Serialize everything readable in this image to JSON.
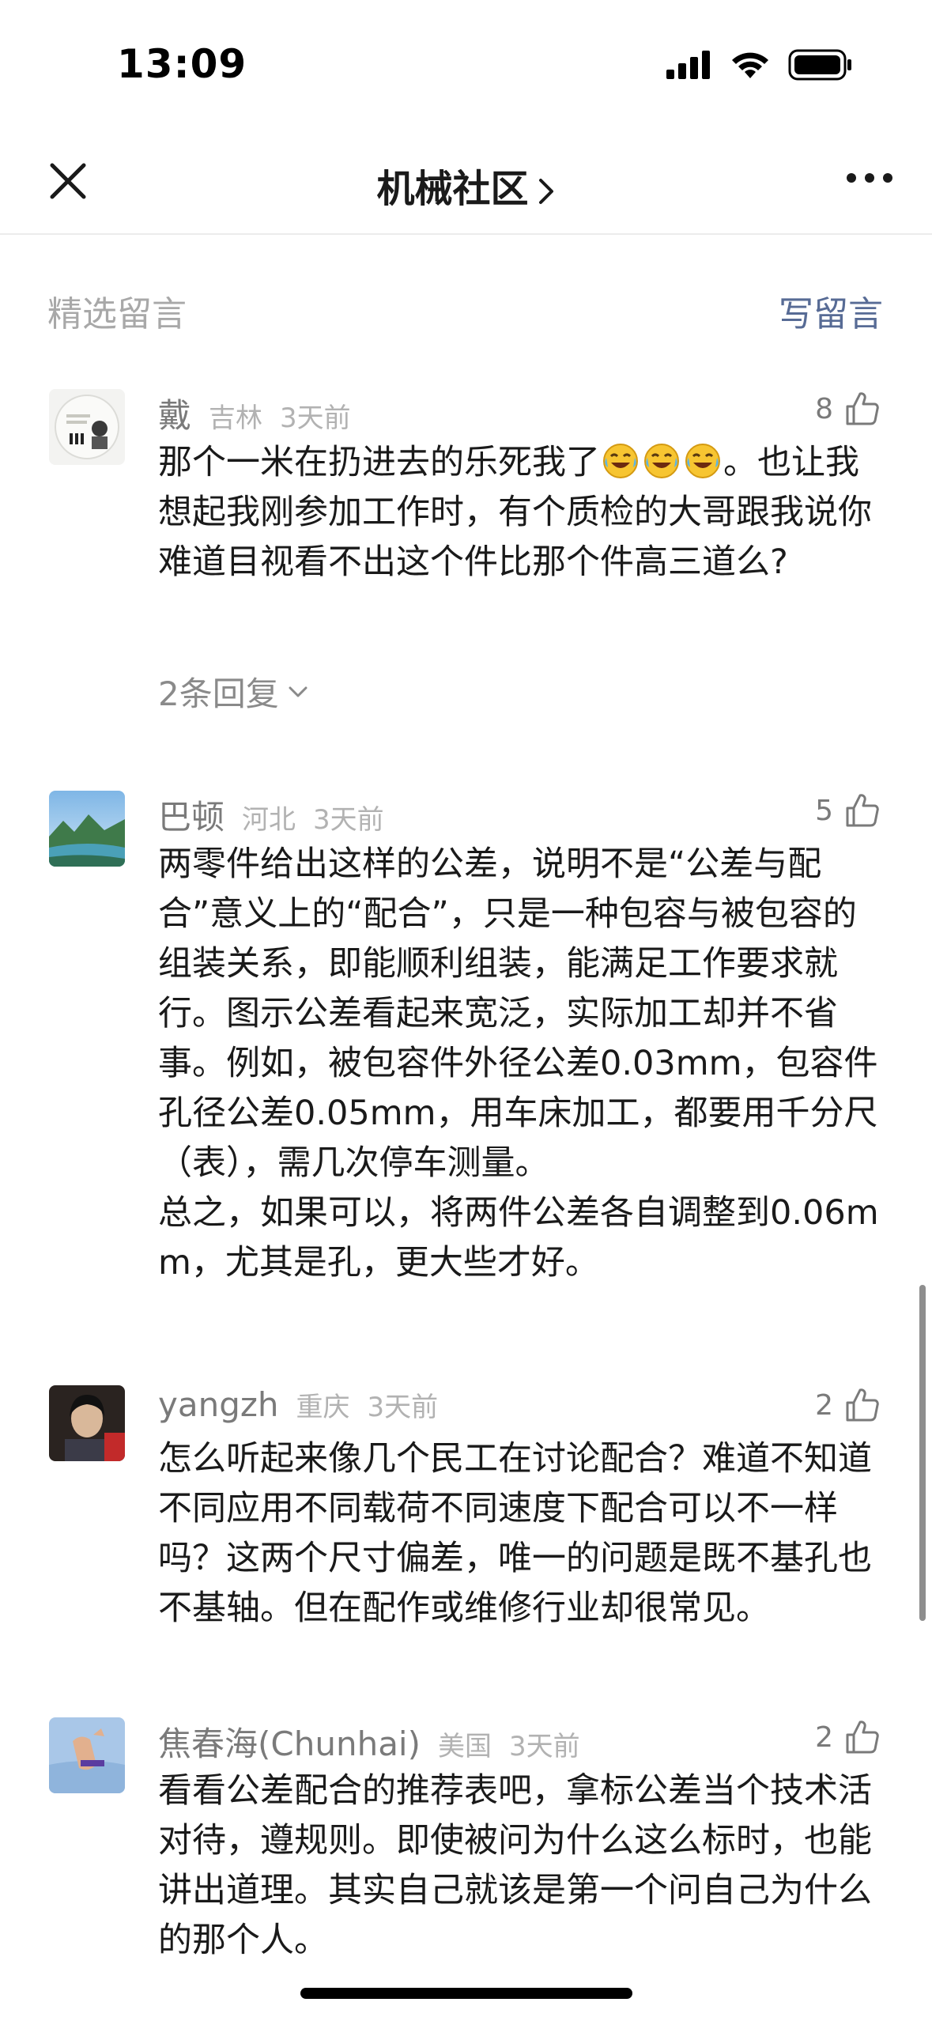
{
  "status": {
    "time": "13:09"
  },
  "nav": {
    "title": "机械社区",
    "close_icon": "close-icon",
    "more_icon": "more-icon"
  },
  "section": {
    "title": "精选留言",
    "write_label": "写留言"
  },
  "colors": {
    "link": "#576b95",
    "muted": "#a8a8a8",
    "text": "#1a1a1a"
  },
  "comments": [
    {
      "name": "戴",
      "location": "吉林",
      "time": "3天前",
      "likes": "8",
      "text_before_emoji": "那个一米在扔进去的乐死我了",
      "emoji": "laughing-crying-emoji",
      "emoji_count": 3,
      "text_after_emoji": "。也让我想起我刚参加工作时，有个质检的大哥跟我说你难道目视看不出这个件比那个件高三道么?",
      "replies": "2条回复"
    },
    {
      "name": "巴顿",
      "location": "河北",
      "time": "3天前",
      "likes": "5",
      "text": "两零件给出这样的公差，说明不是“公差与配合”意义上的“配合”，只是一种包容与被包容的组装关系，即能顺利组装，能满足工作要求就行。图示公差看起来宽泛，实际加工却并不省事。例如，被包容件外径公差0.03mm，包容件孔径公差0.05mm，用车床加工，都要用千分尺（表），需几次停车测量。\n总之，如果可以，将两件公差各自调整到0.06mm，尤其是孔，更大些才好。"
    },
    {
      "name": "yangzh",
      "location": "重庆",
      "time": "3天前",
      "likes": "2",
      "text": "怎么听起来像几个民工在讨论配合？难道不知道不同应用不同载荷不同速度下配合可以不一样吗？这两个尺寸偏差，唯一的问题是既不基孔也不基轴。但在配作或维修行业却很常见。"
    },
    {
      "name": "焦春海(Chunhai)",
      "location": "美国",
      "time": "3天前",
      "likes": "2",
      "text": "看看公差配合的推荐表吧，拿标公差当个技术活对待，遵规则。即使被问为什么这么标时，也能讲出道理。其实自己就该是第一个问自己为什么的那个人。"
    }
  ]
}
